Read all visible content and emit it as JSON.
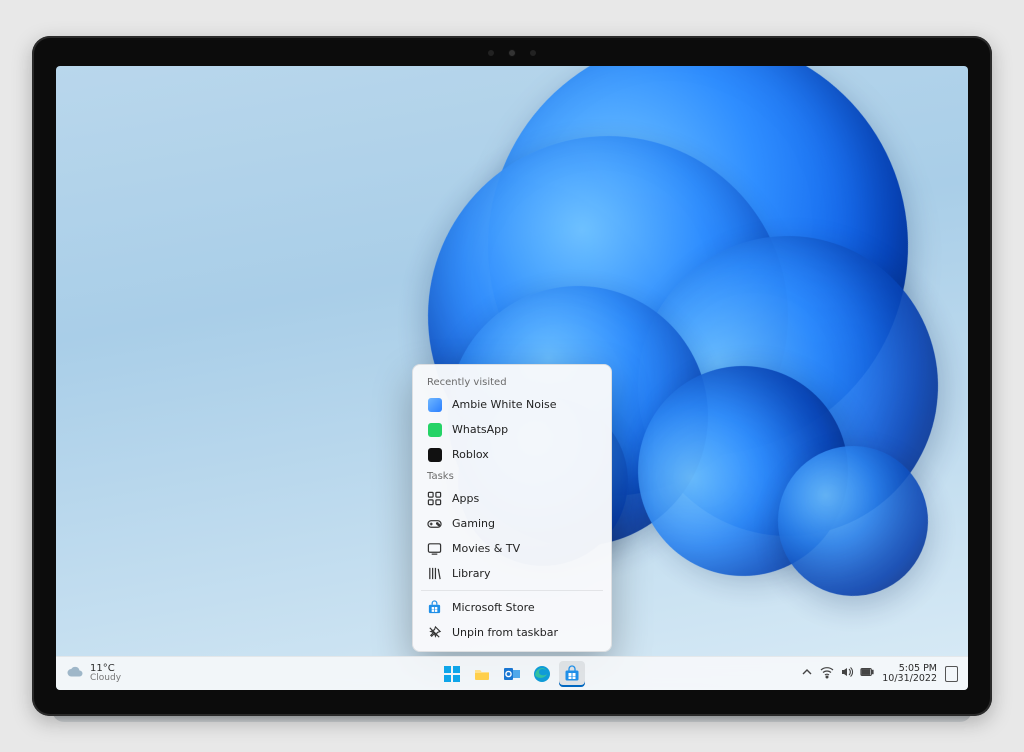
{
  "weather": {
    "temp": "11°C",
    "condition": "Cloudy"
  },
  "jumplist": {
    "headers": {
      "recent": "Recently visited",
      "tasks": "Tasks"
    },
    "recent": [
      {
        "label": "Ambie White Noise"
      },
      {
        "label": "WhatsApp"
      },
      {
        "label": "Roblox"
      }
    ],
    "tasks": [
      {
        "label": "Apps"
      },
      {
        "label": "Gaming"
      },
      {
        "label": "Movies & TV"
      },
      {
        "label": "Library"
      }
    ],
    "store": "Microsoft Store",
    "unpin": "Unpin from taskbar"
  },
  "clock": {
    "time": "5:05 PM",
    "date": "10/31/2022"
  },
  "taskbar_center_icons": [
    "start",
    "explorer",
    "outlook",
    "edge",
    "store"
  ],
  "tray_icons": [
    "chevron-up",
    "wifi",
    "volume",
    "battery"
  ]
}
